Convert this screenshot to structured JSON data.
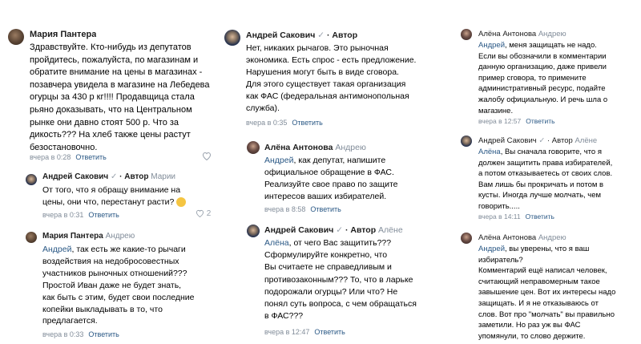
{
  "comments": [
    {
      "author": "Мария Пантера",
      "check": "",
      "badge": "",
      "reply_to": "",
      "mention": "",
      "text": "Здравствуйте. Кто-нибудь из депутатов\nпройдитесь, пожалуйста, по магазинам и\nобратите внимание на цены в магазинах -\nпозавчера увидела в магазине на Лебедева\nогурцы за 430 р кг!!!! Продавщица стала\nрьяно доказывать, что на Центральном\nрынке они давно стоят 500 р. Что за\nдикость??? На хлеб также цены растут\nбезостановочно.",
      "time": "вчера в 0:28",
      "reply_label": "Ответить",
      "likes": ""
    },
    {
      "author": "Андрей Сакович",
      "check": "✓",
      "badge": "· Автор",
      "reply_to": "Марии",
      "mention": "",
      "text": "От того, что я обращу внимание на\nцены, они что, перестанут расти?",
      "time": "вчера в 0:31",
      "reply_label": "Ответить",
      "likes": "2"
    },
    {
      "author": "Мария Пантера",
      "check": "",
      "badge": "",
      "reply_to": "Андрею",
      "mention": "Андрей",
      "text": ", так есть же какие-то рычаги\nвоздействия на недобросовестных\nучастников рыночных отношений???\nПростой Иван даже не будет знать,\nкак быть с этим, будет свои последние\nкопейки выкладывать в то, что\nпредлагается.",
      "time": "вчера в 0:33",
      "reply_label": "Ответить",
      "likes": ""
    },
    {
      "author": "Андрей Сакович",
      "check": "✓",
      "badge": "· Автор",
      "reply_to": "",
      "mention": "",
      "text": "Нет, никаких рычагов. Это рыночная\nэкономика. Есть спрос - есть предложение.\nНарушения могут быть в виде сговора.\nДля этого существует такая организация\nкак ФАС (федеральная антимонопольная\nслужба).",
      "time": "вчера в 0:35",
      "reply_label": "Ответить",
      "likes": ""
    },
    {
      "author": "Алёна Антонова",
      "check": "",
      "badge": "",
      "reply_to": "Андрею",
      "mention": "Андрей",
      "text": ", как депутат, напишите\nофициальное обращение в ФАС.\nРеализуйте свое право по защите\nинтересов ваших избирателей.",
      "time": "вчера в 8:58",
      "reply_label": "Ответить",
      "likes": ""
    },
    {
      "author": "Андрей Сакович",
      "check": "✓",
      "badge": "· Автор",
      "reply_to": "Алёне",
      "mention": "Алёна",
      "text": ", от чего Вас защитить???\nСформулируйте конкретно, что\nВы считаете не справедливым и\nпротивозаконным??? То, что в ларьке\nподорожали огурцы? Или что? Не\nпонял суть вопроса, с чем обращаться\nв ФАС???",
      "time": "вчера в 12:47",
      "reply_label": "Ответить",
      "likes": ""
    },
    {
      "author": "Алёна Антонова",
      "check": "",
      "badge": "",
      "reply_to": "Андрею",
      "mention": "Андрей",
      "text": ", меня защищать не надо.\nЕсли вы обозначили в комментарии\nданную организацию, даже привели\nпример сговора, то примените\nадминистративный ресурс, подайте\nжалобу официальную. И речь шла о\nмагазине.",
      "time": "вчера в 12:57",
      "reply_label": "Ответить",
      "likes": ""
    },
    {
      "author": "Андрей Сакович",
      "check": "✓",
      "badge": "· Автор",
      "reply_to": "Алёне",
      "mention": "Алёна",
      "text": ", Вы сначала говорите, что я\nдолжен защитить права избирателей,\nа потом отказываетесь от своих слов.\nВам лишь бы прокричать и потом в\nкусты. Иногда лучше молчать, чем\nговорить.....",
      "time": "вчера в 14:11",
      "reply_label": "Ответить",
      "likes": ""
    },
    {
      "author": "Алёна Антонова",
      "check": "",
      "badge": "",
      "reply_to": "Андрею",
      "mention": "Андрей",
      "text": ", вы уверены, что я ваш\nизбиратель?\nКомментарий ещё написал человек,\nсчитающий неправомерным такое\nзавышение цен. Вот их интересы надо\nзащищать. И я не отказываюсь от\nслов. Вот про \"молчать\" вы правильно\nзаметили. Но раз уж вы ФАС\nупомянули, то слово держите.",
      "time": "",
      "reply_label": "",
      "likes": ""
    }
  ]
}
